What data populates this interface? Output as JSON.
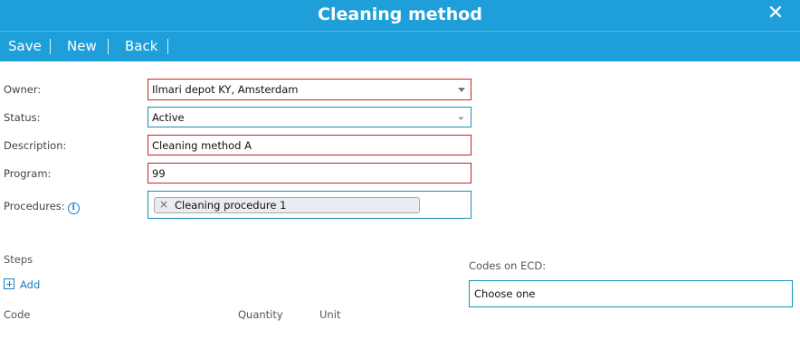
{
  "window": {
    "title": "Cleaning method",
    "close_icon": "close-icon"
  },
  "toolbar": {
    "save_label": "Save",
    "new_label": "New",
    "back_label": "Back"
  },
  "form": {
    "owner_label": "Owner:",
    "owner_value": "Ilmari depot KY, Amsterdam",
    "status_label": "Status:",
    "status_value": "Active",
    "description_label": "Description:",
    "description_value": "Cleaning method A",
    "program_label": "Program:",
    "program_value": "99",
    "procedures_label": "Procedures:",
    "procedures_info_icon": "info-icon",
    "procedures_tags": [
      "Cleaning procedure 1"
    ]
  },
  "steps": {
    "title": "Steps",
    "add_label": "Add",
    "columns": [
      "Code",
      "Quantity",
      "Unit"
    ]
  },
  "ecd": {
    "label": "Codes on ECD:",
    "value": "Choose one"
  },
  "colors": {
    "accent": "#1f9fd9",
    "error_border": "#cc2222",
    "valid_border": "#1a8fb7"
  }
}
